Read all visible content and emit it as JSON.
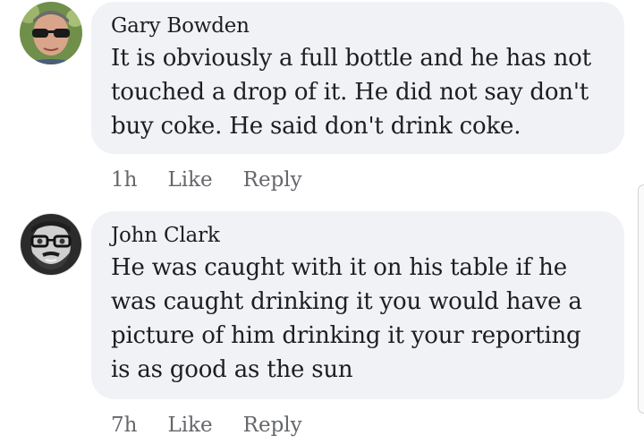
{
  "comments": [
    {
      "author": "Gary Bowden",
      "text": "It is obviously a full bottle and he has not touched a drop of it. He did not say don't buy coke. He said don't drink coke.",
      "time": "1h",
      "like_label": "Like",
      "reply_label": "Reply",
      "avatar_icon": "man-sunglasses-avatar"
    },
    {
      "author": "John Clark",
      "text": "He was caught with it on his table if he was caught drinking it you would have a picture of him drinking it your reporting is as good as the sun",
      "time": "7h",
      "like_label": "Like",
      "reply_label": "Reply",
      "avatar_icon": "man-glasses-beard-avatar"
    }
  ],
  "colors": {
    "bubble": "#f0f2f5",
    "text": "#1c1e21",
    "meta": "#65676b"
  }
}
